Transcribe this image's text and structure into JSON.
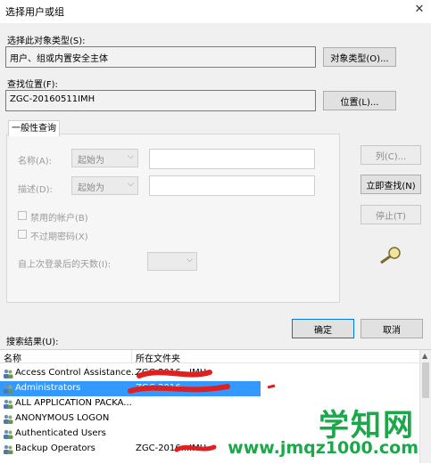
{
  "window": {
    "title": "选择用户或组"
  },
  "object_type": {
    "label": "选择此对象类型(S):",
    "value": "用户、组或内置安全主体",
    "button": "对象类型(O)..."
  },
  "location": {
    "label": "查找位置(F):",
    "value": "ZGC-20160511IMH",
    "button": "位置(L)..."
  },
  "query": {
    "tab": "一般性查询",
    "name_label": "名称(A):",
    "desc_label": "描述(D):",
    "starts_with": "起始为",
    "disabled_accounts": "禁用的帐户(B)",
    "non_expiring_password": "不过期密码(X)",
    "days_since_logon": "自上次登录后的天数(I):"
  },
  "buttons": {
    "columns": "列(C)...",
    "find_now": "立即查找(N)",
    "stop": "停止(T)",
    "ok": "确定",
    "cancel": "取消"
  },
  "results": {
    "label": "搜索结果(U):",
    "columns": [
      "名称",
      "所在文件夹"
    ],
    "rows": [
      {
        "name": "Access Control Assistance...",
        "folder": "ZGC-2016...IMH",
        "selected": false
      },
      {
        "name": "Administrators",
        "folder": "ZGC-2016...",
        "selected": true
      },
      {
        "name": "ALL APPLICATION PACKA...",
        "folder": "",
        "selected": false
      },
      {
        "name": "ANONYMOUS LOGON",
        "folder": "",
        "selected": false
      },
      {
        "name": "Authenticated Users",
        "folder": "",
        "selected": false
      },
      {
        "name": "Backup Operators",
        "folder": "ZGC-2016...IMH",
        "selected": false
      }
    ]
  },
  "watermark": {
    "main": "学知网",
    "url": "www.jmqz1000.com"
  },
  "colors": {
    "selection": "#3399ff",
    "annotation": "#e02020",
    "watermark": "#1aa84a"
  }
}
